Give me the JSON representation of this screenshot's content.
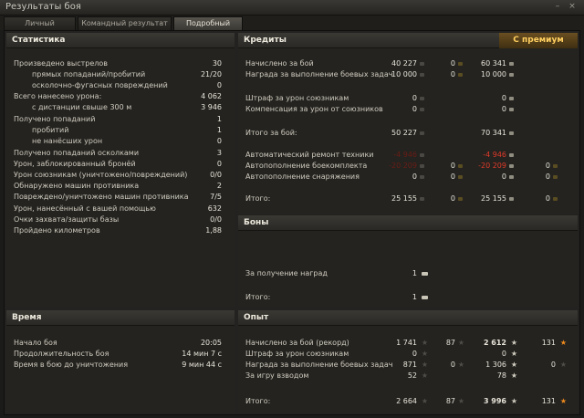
{
  "window": {
    "title": "Результаты боя"
  },
  "tabs": [
    {
      "label": "Личный результат"
    },
    {
      "label": "Командный результат"
    },
    {
      "label": "Подробный отчёт"
    }
  ],
  "stats": {
    "title": "Статистика",
    "rows": [
      {
        "label": "Произведено выстрелов",
        "value": "30"
      },
      {
        "label": "прямых попаданий/пробитий",
        "value": "21/20"
      },
      {
        "label": "осколочно-фугасных повреждений",
        "value": "0"
      },
      {
        "label": "Всего нанесено урона:",
        "value": "4 062"
      },
      {
        "label": "с дистанции свыше 300 м",
        "value": "3 946"
      },
      {
        "label": "Получено попаданий",
        "value": "1"
      },
      {
        "label": "пробитий",
        "value": "1"
      },
      {
        "label": "не нанёсших урон",
        "value": "0"
      },
      {
        "label": "Получено попаданий осколками",
        "value": "3"
      },
      {
        "label": "Урон, заблокированный бронёй",
        "value": "0"
      },
      {
        "label": "Урон союзникам (уничтожено/повреждений)",
        "value": "0/0"
      },
      {
        "label": "Обнаружено машин противника",
        "value": "2"
      },
      {
        "label": "Повреждено/уничтожено машин противника",
        "value": "7/5"
      },
      {
        "label": "Урон, нанесённый с вашей помощью",
        "value": "632"
      },
      {
        "label": "Очки захвата/защиты базы",
        "value": "0/0"
      },
      {
        "label": "Пройдено километров",
        "value": "1,88"
      }
    ]
  },
  "credits": {
    "title": "Кредиты",
    "premium_label": "С премиум",
    "rows": [
      {
        "label": "Начислено за бой",
        "base": "40 227",
        "base_gold": "0",
        "prem": "60 341",
        "prem_gold": ""
      },
      {
        "label": "Награда за выполнение боевых задач",
        "base": "10 000",
        "base_gold": "0",
        "prem": "10 000",
        "prem_gold": ""
      },
      {
        "label": "Штраф за урон союзникам",
        "base": "0",
        "base_gold": "",
        "prem": "0",
        "prem_gold": ""
      },
      {
        "label": "Компенсация за урон от союзников",
        "base": "0",
        "base_gold": "",
        "prem": "0",
        "prem_gold": ""
      },
      {
        "label": "Итого за бой:",
        "base": "50 227",
        "base_gold": "",
        "prem": "70 341",
        "prem_gold": ""
      },
      {
        "label": "Автоматический ремонт техники",
        "base": "-4 946",
        "base_gold": "",
        "prem": "-4 946",
        "prem_gold": ""
      },
      {
        "label": "Автопополнение боекомплекта",
        "base": "-20 209",
        "base_gold": "0",
        "prem": "-20 209",
        "prem_gold": "0"
      },
      {
        "label": "Автопополнение снаряжения",
        "base": "0",
        "base_gold": "0",
        "prem": "0",
        "prem_gold": "0"
      },
      {
        "label": "Итого:",
        "base": "25 155",
        "base_gold": "0",
        "prem": "25 155",
        "prem_gold": "0"
      }
    ]
  },
  "bonds": {
    "title": "Боны",
    "rows": [
      {
        "label": "За получение наград",
        "value": "1"
      },
      {
        "label": "Итого:",
        "value": "1"
      }
    ]
  },
  "time": {
    "title": "Время",
    "rows": [
      {
        "label": "Начало боя",
        "value": "20:05"
      },
      {
        "label": "Продолжительность боя",
        "value": "14 мин 7 с"
      },
      {
        "label": "Время в бою до уничтожения",
        "value": "9 мин 44 с"
      }
    ]
  },
  "exp": {
    "title": "Опыт",
    "rows": [
      {
        "label": "Начислено за бой (рекорд)",
        "base": "1 741",
        "base_free": "87",
        "prem": "2 612",
        "prem_free": "131"
      },
      {
        "label": "Штраф за урон союзникам",
        "base": "0",
        "base_free": "",
        "prem": "0",
        "prem_free": ""
      },
      {
        "label": "Награда за выполнение боевых задач",
        "base": "871",
        "base_free": "0",
        "prem": "1 306",
        "prem_free": "0"
      },
      {
        "label": "За игру взводом",
        "base": "52",
        "base_free": "",
        "prem": "78",
        "prem_free": ""
      },
      {
        "label": "Итого:",
        "base": "2 664",
        "base_free": "87",
        "prem": "3 996",
        "prem_free": "131"
      }
    ]
  }
}
